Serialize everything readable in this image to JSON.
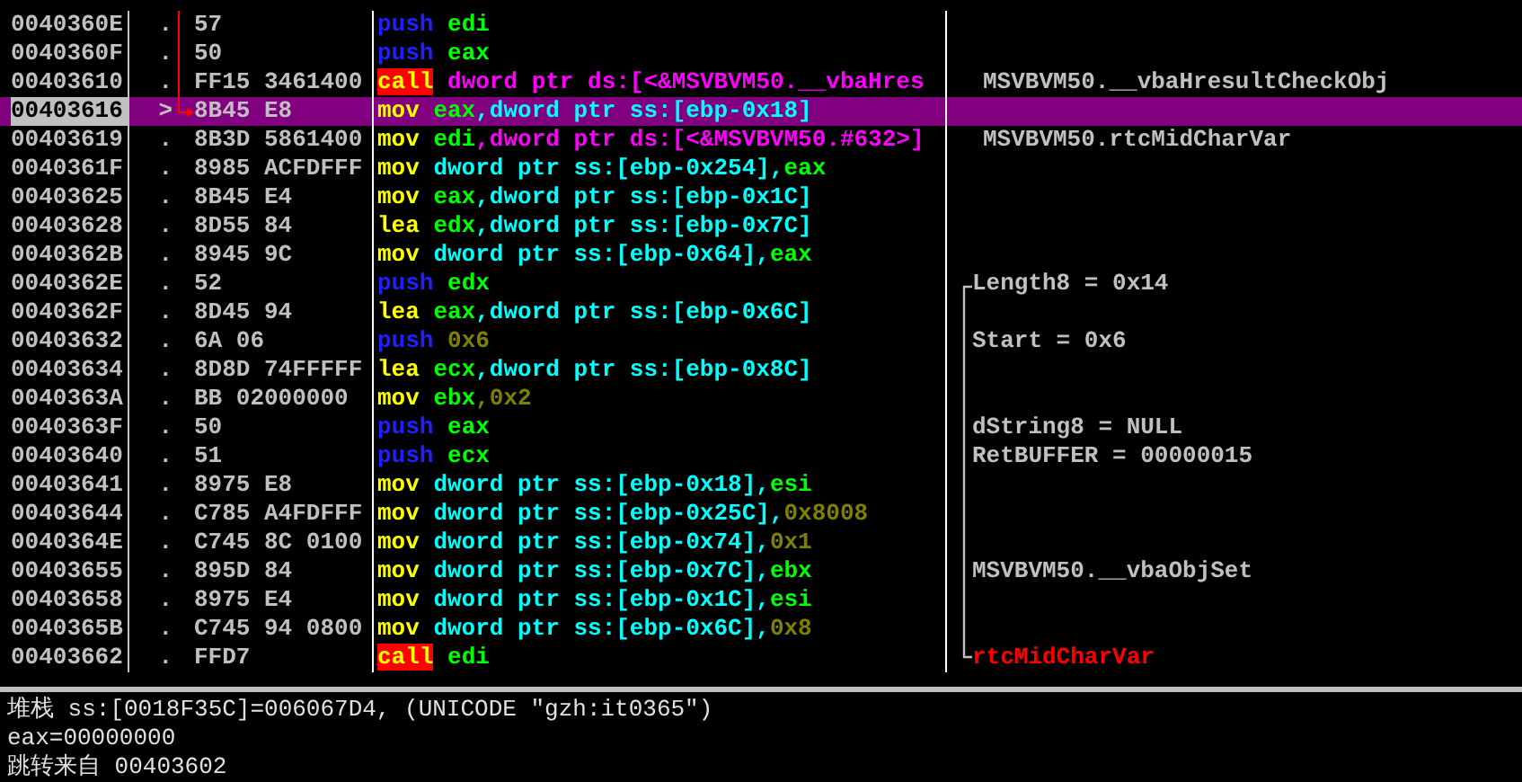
{
  "rows": [
    {
      "kind": "jump-through",
      "address": "0040360E",
      "marker": ".",
      "hex": "57",
      "selected": false,
      "asm": [
        {
          "text": "push",
          "kind": "op-push"
        },
        {
          "text": "edi",
          "kind": "reg"
        }
      ]
    },
    {
      "kind": "jump-through",
      "address": "0040360F",
      "marker": ".",
      "hex": "50",
      "selected": false,
      "asm": [
        {
          "text": "push",
          "kind": "op-push"
        },
        {
          "text": "eax",
          "kind": "reg"
        }
      ]
    },
    {
      "kind": "jump-through",
      "address": "00403610",
      "marker": ".",
      "hex": "FF15 3461400",
      "selected": false,
      "asm": [
        {
          "text": "call",
          "kind": "op-call"
        },
        {
          "text": "dword ptr ds:[<&MSVBVM50.__vbaHres",
          "kind": "ds"
        }
      ],
      "comment": {
        "text": "MSVBVM50.__vbaHresultCheckObj",
        "kind": "api"
      }
    },
    {
      "kind": "jump-target",
      "address": "00403616",
      "marker": ">",
      "hex": "8B45 E8",
      "selected": true,
      "asm": [
        {
          "text": "mov",
          "kind": "op-move"
        },
        {
          "text": "eax",
          "kind": "reg"
        },
        {
          "text": ",dword ptr ss:[ebp-0x18]",
          "kind": "mem"
        }
      ]
    },
    {
      "kind": "plain",
      "address": "00403619",
      "marker": ".",
      "hex": "8B3D 5861400",
      "selected": false,
      "asm": [
        {
          "text": "mov",
          "kind": "op-move"
        },
        {
          "text": "edi",
          "kind": "reg"
        },
        {
          "text": ",dword ptr ds:[<&MSVBVM50.#632>]",
          "kind": "ds"
        }
      ],
      "comment": {
        "text": "MSVBVM50.rtcMidCharVar",
        "kind": "api"
      }
    },
    {
      "kind": "plain",
      "address": "0040361F",
      "marker": ".",
      "hex": "8985 ACFDFFF",
      "selected": false,
      "asm": [
        {
          "text": "mov",
          "kind": "op-move"
        },
        {
          "text": "dword ptr ss:[ebp-0x254],",
          "kind": "mem"
        },
        {
          "text": "eax",
          "kind": "reg"
        }
      ]
    },
    {
      "kind": "plain",
      "address": "00403625",
      "marker": ".",
      "hex": "8B45 E4",
      "selected": false,
      "asm": [
        {
          "text": "mov",
          "kind": "op-move"
        },
        {
          "text": "eax",
          "kind": "reg"
        },
        {
          "text": ",dword ptr ss:[ebp-0x1C]",
          "kind": "mem"
        }
      ]
    },
    {
      "kind": "plain",
      "address": "00403628",
      "marker": ".",
      "hex": "8D55 84",
      "selected": false,
      "asm": [
        {
          "text": "lea",
          "kind": "op-move"
        },
        {
          "text": "edx",
          "kind": "reg"
        },
        {
          "text": ",dword ptr ss:[ebp-0x7C]",
          "kind": "mem"
        }
      ]
    },
    {
      "kind": "plain",
      "address": "0040362B",
      "marker": ".",
      "hex": "8945 9C",
      "selected": false,
      "asm": [
        {
          "text": "mov",
          "kind": "op-move"
        },
        {
          "text": "dword ptr ss:[ebp-0x64],",
          "kind": "mem"
        },
        {
          "text": "eax",
          "kind": "reg"
        }
      ]
    },
    {
      "kind": "plain",
      "address": "0040362E",
      "marker": ".",
      "hex": "52",
      "selected": false,
      "asm": [
        {
          "text": "push",
          "kind": "op-push"
        },
        {
          "text": "edx",
          "kind": "reg"
        }
      ],
      "comment": {
        "text": "Length8 = 0x14",
        "kind": "arg-open"
      }
    },
    {
      "kind": "plain",
      "address": "0040362F",
      "marker": ".",
      "hex": "8D45 94",
      "selected": false,
      "asm": [
        {
          "text": "lea",
          "kind": "op-move"
        },
        {
          "text": "eax",
          "kind": "reg"
        },
        {
          "text": ",dword ptr ss:[ebp-0x6C]",
          "kind": "mem"
        }
      ],
      "comment": {
        "kind": "gap"
      }
    },
    {
      "kind": "plain",
      "address": "00403632",
      "marker": ".",
      "hex": "6A 06",
      "selected": false,
      "asm": [
        {
          "text": "push",
          "kind": "op-push"
        },
        {
          "text": "0x6",
          "kind": "imm"
        }
      ],
      "comment": {
        "text": "Start = 0x6",
        "kind": "arg"
      }
    },
    {
      "kind": "plain",
      "address": "00403634",
      "marker": ".",
      "hex": "8D8D 74FFFFF",
      "selected": false,
      "asm": [
        {
          "text": "lea",
          "kind": "op-move"
        },
        {
          "text": "ecx",
          "kind": "reg"
        },
        {
          "text": ",dword ptr ss:[ebp-0x8C]",
          "kind": "mem"
        }
      ],
      "comment": {
        "kind": "gap"
      }
    },
    {
      "kind": "plain",
      "address": "0040363A",
      "marker": ".",
      "hex": "BB 02000000",
      "selected": false,
      "asm": [
        {
          "text": "mov",
          "kind": "op-move"
        },
        {
          "text": "ebx",
          "kind": "reg"
        },
        {
          "text": ",0x2",
          "kind": "imm"
        }
      ],
      "comment": {
        "kind": "gap"
      }
    },
    {
      "kind": "plain",
      "address": "0040363F",
      "marker": ".",
      "hex": "50",
      "selected": false,
      "asm": [
        {
          "text": "push",
          "kind": "op-push"
        },
        {
          "text": "eax",
          "kind": "reg"
        }
      ],
      "comment": {
        "text": "dString8 = NULL",
        "kind": "arg"
      }
    },
    {
      "kind": "plain",
      "address": "00403640",
      "marker": ".",
      "hex": "51",
      "selected": false,
      "asm": [
        {
          "text": "push",
          "kind": "op-push"
        },
        {
          "text": "ecx",
          "kind": "reg"
        }
      ],
      "comment": {
        "text": "RetBUFFER = 00000015",
        "kind": "arg"
      }
    },
    {
      "kind": "plain",
      "address": "00403641",
      "marker": ".",
      "hex": "8975 E8",
      "selected": false,
      "asm": [
        {
          "text": "mov",
          "kind": "op-move"
        },
        {
          "text": "dword ptr ss:[ebp-0x18],",
          "kind": "mem"
        },
        {
          "text": "esi",
          "kind": "reg"
        }
      ],
      "comment": {
        "kind": "gap"
      }
    },
    {
      "kind": "plain",
      "address": "00403644",
      "marker": ".",
      "hex": "C785 A4FDFFF",
      "selected": false,
      "asm": [
        {
          "text": "mov",
          "kind": "op-move"
        },
        {
          "text": "dword ptr ss:[ebp-0x25C],",
          "kind": "mem"
        },
        {
          "text": "0x8008",
          "kind": "imm"
        }
      ],
      "comment": {
        "kind": "gap"
      }
    },
    {
      "kind": "plain",
      "address": "0040364E",
      "marker": ".",
      "hex": "C745 8C 0100",
      "selected": false,
      "asm": [
        {
          "text": "mov",
          "kind": "op-move"
        },
        {
          "text": "dword ptr ss:[ebp-0x74],",
          "kind": "mem"
        },
        {
          "text": "0x1",
          "kind": "imm"
        }
      ],
      "comment": {
        "kind": "gap"
      }
    },
    {
      "kind": "plain",
      "address": "00403655",
      "marker": ".",
      "hex": "895D 84",
      "selected": false,
      "asm": [
        {
          "text": "mov",
          "kind": "op-move"
        },
        {
          "text": "dword ptr ss:[ebp-0x7C],",
          "kind": "mem"
        },
        {
          "text": "ebx",
          "kind": "reg"
        }
      ],
      "comment": {
        "text": "MSVBVM50.__vbaObjSet",
        "kind": "arg"
      }
    },
    {
      "kind": "plain",
      "address": "00403658",
      "marker": ".",
      "hex": "8975 E4",
      "selected": false,
      "asm": [
        {
          "text": "mov",
          "kind": "op-move"
        },
        {
          "text": "dword ptr ss:[ebp-0x1C],",
          "kind": "mem"
        },
        {
          "text": "esi",
          "kind": "reg"
        }
      ],
      "comment": {
        "kind": "gap"
      }
    },
    {
      "kind": "plain",
      "address": "0040365B",
      "marker": ".",
      "hex": "C745 94 0800",
      "selected": false,
      "asm": [
        {
          "text": "mov",
          "kind": "op-move"
        },
        {
          "text": "dword ptr ss:[ebp-0x6C],",
          "kind": "mem"
        },
        {
          "text": "0x8",
          "kind": "imm"
        }
      ],
      "comment": {
        "kind": "gap"
      }
    },
    {
      "kind": "plain",
      "address": "00403662",
      "marker": ".",
      "hex": "FFD7",
      "selected": false,
      "asm": [
        {
          "text": "call",
          "kind": "op-call"
        },
        {
          "text": "edi",
          "kind": "reg"
        }
      ],
      "comment": {
        "text": "rtcMidCharVar",
        "kind": "call-close"
      }
    }
  ],
  "info_lines": [
    "堆栈 ss:[0018F35C]=006067D4, (UNICODE \"gzh:it0365\")",
    "eax=00000000",
    "跳转来自 00403602"
  ]
}
